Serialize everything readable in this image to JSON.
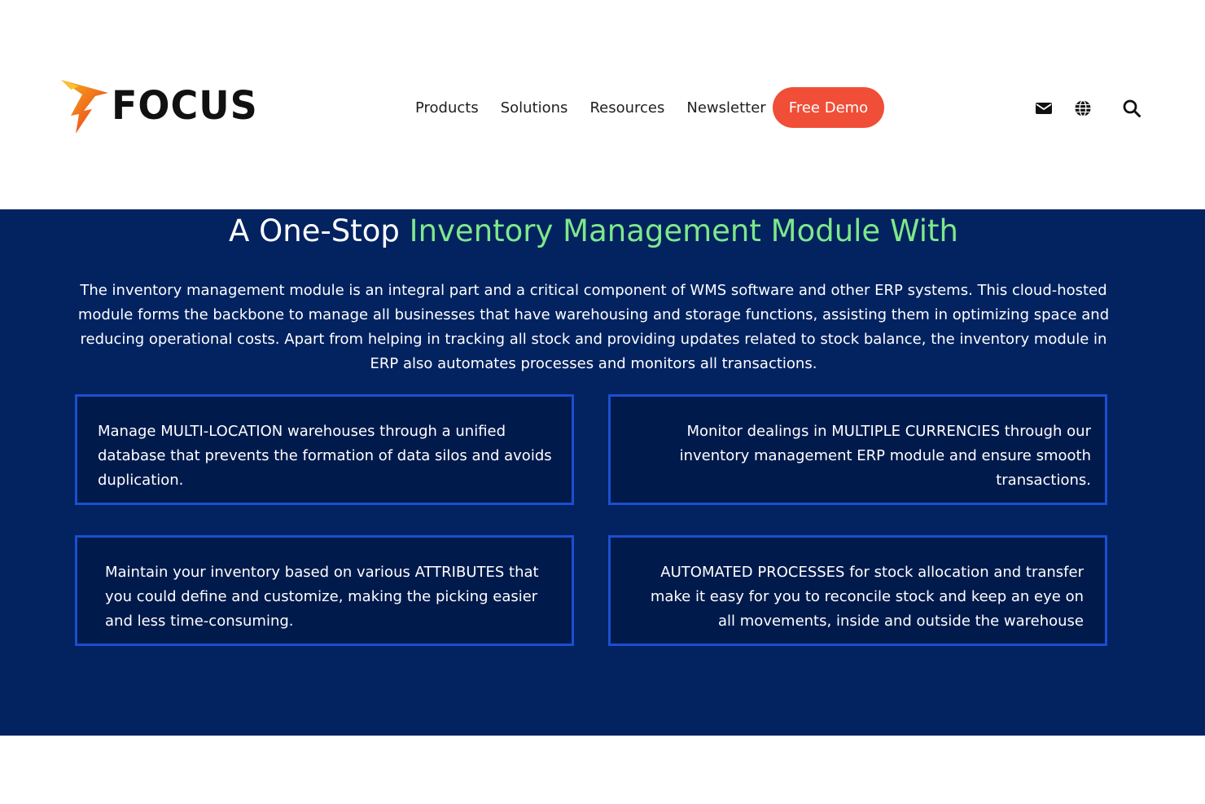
{
  "header": {
    "logo_text": "FOCUS",
    "nav": [
      "Products",
      "Solutions",
      "Resources",
      "Newsletter"
    ],
    "cta_label": "Free Demo",
    "icons": [
      "mail-icon",
      "globe-icon",
      "search-icon"
    ]
  },
  "hero": {
    "title_prefix": "A One-Stop ",
    "title_highlight": "Inventory Management Module With",
    "intro": "The inventory management module is an integral part and a critical component of WMS software and other ERP systems. This cloud-hosted module forms the backbone to manage all businesses that have warehousing and storage functions, assisting them in optimizing space and reducing operational costs. Apart from helping in tracking all stock and providing updates related to stock balance, the inventory module in ERP also automates processes and monitors all transactions."
  },
  "features": [
    {
      "text": "Manage MULTI-LOCATION warehouses through a unified database that prevents the formation of data silos and avoids duplication."
    },
    {
      "text": "Monitor dealings in MULTIPLE CURRENCIES through our inventory management ERP module and ensure smooth transactions."
    },
    {
      "text": "Maintain your inventory based on various ATTRIBUTES that you could define and customize, making the picking easier and less time-consuming."
    },
    {
      "text": "AUTOMATED PROCESSES for stock allocation and transfer make it easy for you to reconcile stock and keep an eye on all movements, inside and outside the warehouse"
    }
  ],
  "colors": {
    "section_bg": "#022260",
    "card_bg": "#011a4c",
    "card_border": "#1a4fd0",
    "highlight": "#7ee88a",
    "cta": "#f04e37"
  }
}
